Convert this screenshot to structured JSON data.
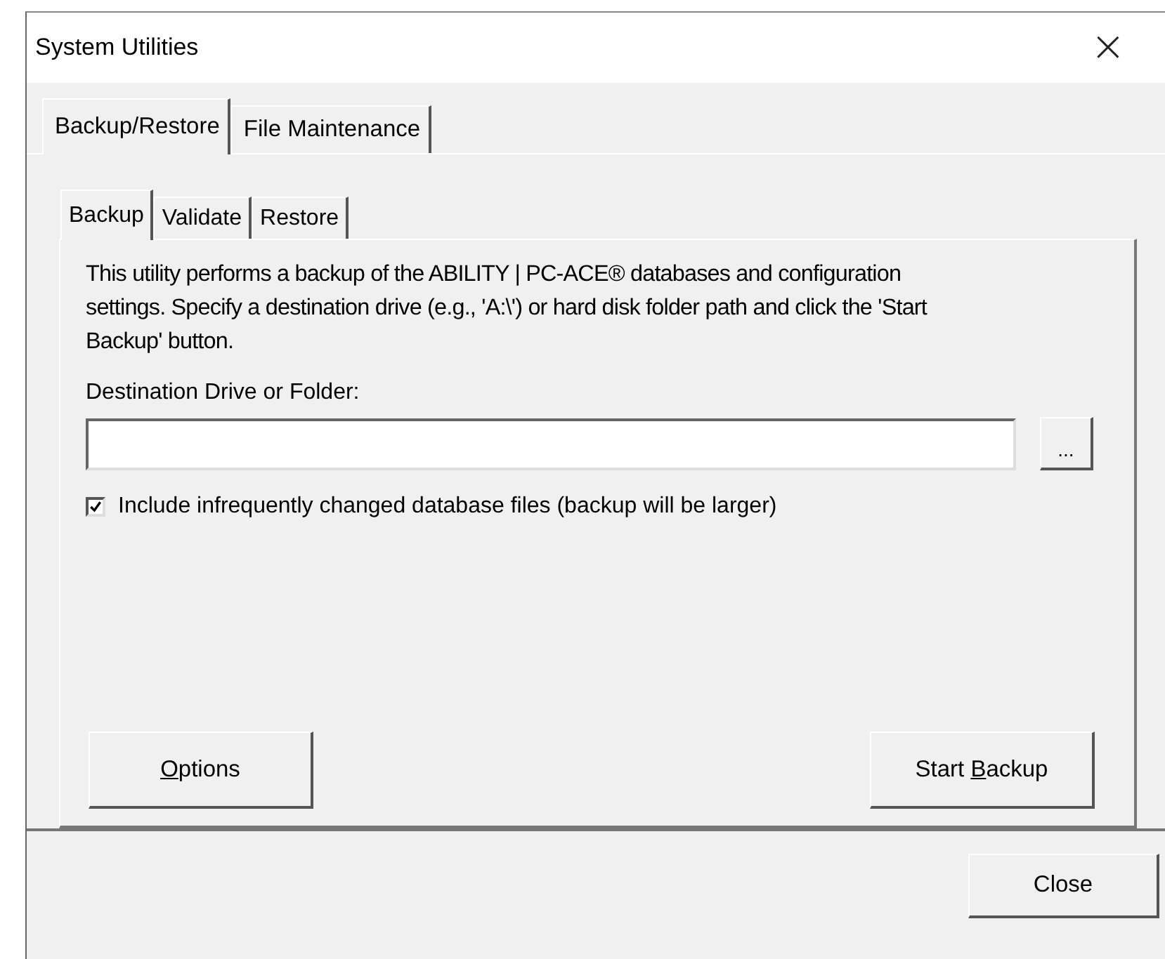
{
  "window": {
    "title": "System Utilities",
    "close": "×"
  },
  "tabs": [
    {
      "label": "Backup/Restore",
      "selected": true
    },
    {
      "label": "File Maintenance",
      "selected": false
    }
  ],
  "subtabs": [
    {
      "label": "Backup",
      "selected": true
    },
    {
      "label": "Validate",
      "selected": false
    },
    {
      "label": "Restore",
      "selected": false
    }
  ],
  "description": "This utility performs a backup of the ABILITY | PC-ACE® databases and configuration settings. Specify a destination drive (e.g., 'A:\\') or hard disk folder path and click the 'Start Backup' button.",
  "destination": {
    "label": "Destination Drive or Folder:",
    "browse": "..."
  },
  "include_option": {
    "label": "Include infrequently changed database files (backup will be larger)",
    "checked": true
  },
  "buttons": [
    {
      "key": "O",
      "after": "ptions"
    },
    {
      "before": "Start ",
      "key": "B",
      "after": "ackup"
    }
  ],
  "close_button": "Close"
}
